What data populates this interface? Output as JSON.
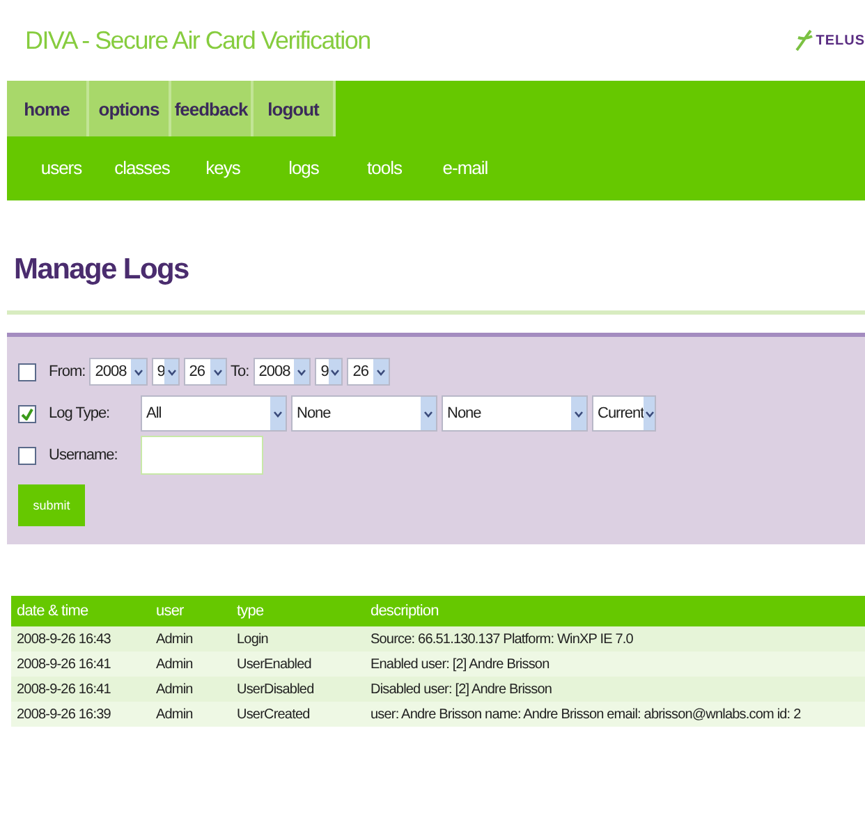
{
  "header": {
    "title": "DIVA - Secure Air Card Verification",
    "logo_text": "TELUS"
  },
  "nav_primary": [
    {
      "label": "home"
    },
    {
      "label": "options"
    },
    {
      "label": "feedback"
    },
    {
      "label": "logout"
    }
  ],
  "nav_secondary": [
    {
      "label": "users"
    },
    {
      "label": "classes"
    },
    {
      "label": "keys"
    },
    {
      "label": "logs"
    },
    {
      "label": "tools"
    },
    {
      "label": "e-mail"
    }
  ],
  "page_title": "Manage Logs",
  "filters": {
    "date": {
      "checked": false,
      "from_label": "From:",
      "to_label": "To:",
      "from": [
        "2008",
        "9",
        "26"
      ],
      "to": [
        "2008",
        "9",
        "26"
      ]
    },
    "log_type": {
      "checked": true,
      "label": "Log Type:",
      "selects": [
        "All",
        "None",
        "None",
        "Current"
      ]
    },
    "username": {
      "checked": false,
      "label": "Username:"
    },
    "submit": "submit"
  },
  "table": {
    "columns": [
      "date & time",
      "user",
      "type",
      "description"
    ],
    "rows": [
      [
        "2008-9-26 16:43",
        "Admin",
        "Login",
        "Source: 66.51.130.137 Platform: WinXP IE 7.0"
      ],
      [
        "2008-9-26 16:41",
        "Admin",
        "UserEnabled",
        "Enabled user: [2] Andre Brisson"
      ],
      [
        "2008-9-26 16:41",
        "Admin",
        "UserDisabled",
        "Disabled user: [2] Andre Brisson"
      ],
      [
        "2008-9-26 16:39",
        "Admin",
        "UserCreated",
        "user: Andre Brisson name: Andre Brisson email: abrisson@wnlabs.com id: 2"
      ]
    ]
  }
}
